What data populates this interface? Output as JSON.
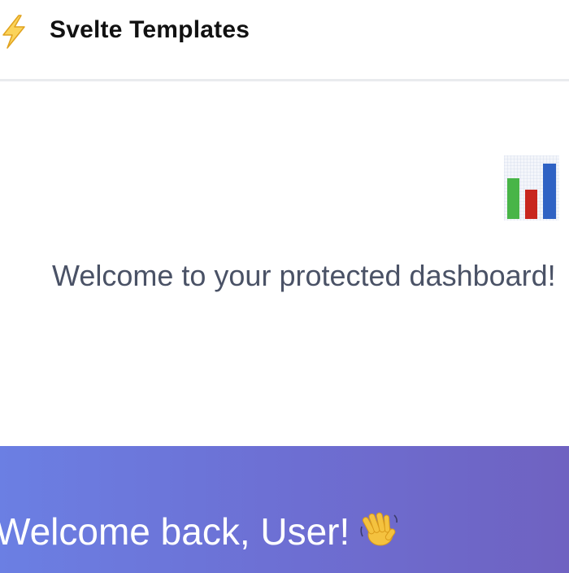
{
  "header": {
    "brand_icon": "lightning-bolt-icon",
    "title": "Svelte Templates"
  },
  "dashboard": {
    "icon": "bar-chart-icon",
    "message": "Welcome to your protected dashboard!"
  },
  "banner": {
    "message": "Welcome back, User!",
    "icon": "waving-hand-icon"
  },
  "colors": {
    "banner_start": "#6b7fe3",
    "banner_end": "#6f62c1",
    "text_muted": "#4a5266",
    "logo_yellow": "#f2b830"
  }
}
